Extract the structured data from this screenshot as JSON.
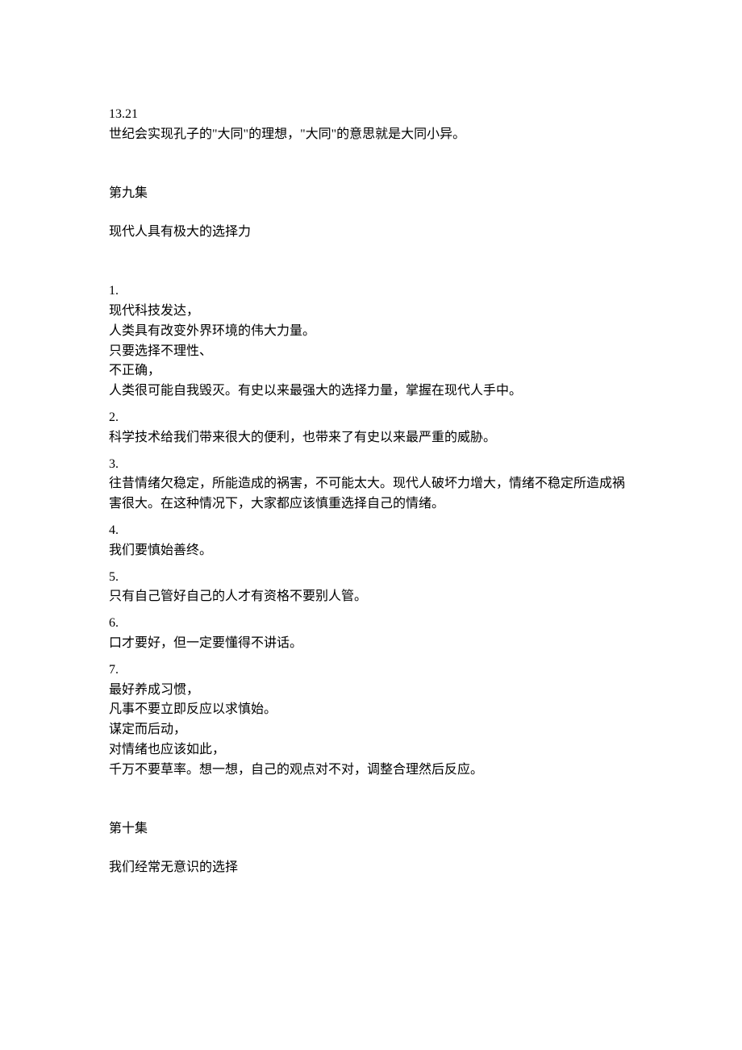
{
  "opening": {
    "num": "13.21",
    "text": "世纪会实现孔子的\"大同\"的理想，\"大同\"的意思就是大同小异。"
  },
  "section9": {
    "heading": "第九集",
    "subtitle": "现代人具有极大的选择力",
    "items": [
      {
        "num": "1.",
        "lines": [
          "现代科技发达，",
          "人类具有改变外界环境的伟大力量。",
          "只要选择不理性、",
          "不正确，",
          "人类很可能自我毁灭。有史以来最强大的选择力量，掌握在现代人手中。"
        ]
      },
      {
        "num": "2.",
        "lines": [
          "科学技术给我们带来很大的便利，也带来了有史以来最严重的威胁。"
        ]
      },
      {
        "num": "3.",
        "lines": [
          "往昔情绪欠稳定，所能造成的祸害，不可能太大。现代人破坏力增大，情绪不稳定所造成祸害很大。在这种情况下，大家都应该慎重选择自己的情绪。"
        ]
      },
      {
        "num": "4.",
        "lines": [
          "我们要慎始善终。"
        ]
      },
      {
        "num": "5.",
        "lines": [
          "只有自己管好自己的人才有资格不要别人管。"
        ]
      },
      {
        "num": "6.",
        "lines": [
          "口才要好，但一定要懂得不讲话。"
        ]
      },
      {
        "num": "7.",
        "lines": [
          "最好养成习惯，",
          "凡事不要立即反应以求慎始。",
          "谋定而后动，",
          "对情绪也应该如此，",
          "千万不要草率。想一想，自己的观点对不对，调整合理然后反应。"
        ]
      }
    ]
  },
  "section10": {
    "heading": "第十集",
    "subtitle": "我们经常无意识的选择"
  }
}
